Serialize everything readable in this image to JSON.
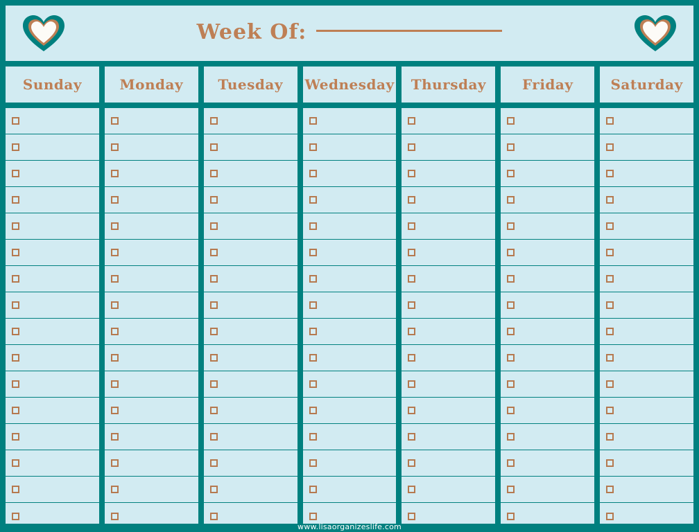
{
  "page": {
    "title": "Weekly Planner",
    "background_color": "#00807f",
    "cell_color": "#d2ebf2",
    "accent_color": "#be7f55",
    "checkbox_border_color": "#b5794f"
  },
  "header": {
    "week_of_label": "Week Of:",
    "week_of_value": "",
    "left_heart_icon": "heart-icon",
    "right_heart_icon": "heart-icon",
    "heart_outer_color": "#00807f",
    "heart_ring_color": "#be7f55",
    "heart_inner_color": "#fdfbf7"
  },
  "days": [
    {
      "label": "Sunday"
    },
    {
      "label": "Monday"
    },
    {
      "label": "Tuesday"
    },
    {
      "label": "Wednesday"
    },
    {
      "label": "Thursday"
    },
    {
      "label": "Friday"
    },
    {
      "label": "Saturday"
    }
  ],
  "grid": {
    "rows": 16,
    "checkbox_icon": "checkbox-empty-icon",
    "entries": [
      {
        "value": ""
      },
      {
        "value": ""
      },
      {
        "value": ""
      },
      {
        "value": ""
      },
      {
        "value": ""
      },
      {
        "value": ""
      },
      {
        "value": ""
      },
      {
        "value": ""
      },
      {
        "value": ""
      },
      {
        "value": ""
      },
      {
        "value": ""
      },
      {
        "value": ""
      },
      {
        "value": ""
      },
      {
        "value": ""
      },
      {
        "value": ""
      },
      {
        "value": ""
      }
    ]
  },
  "footer": {
    "website": "www.lisaorganizeslife.com"
  }
}
